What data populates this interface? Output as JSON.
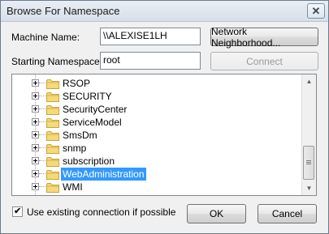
{
  "window": {
    "title": "Browse For Namespace",
    "close_glyph": "✕"
  },
  "machine": {
    "label": "Machine Name:",
    "value": "\\\\ALEXISE1LH"
  },
  "namespace": {
    "label": "Starting Namespace:",
    "value": "root"
  },
  "buttons": {
    "network": "Network Neighborhood...",
    "connect": "Connect",
    "ok": "OK",
    "cancel": "Cancel"
  },
  "tree": {
    "items": [
      {
        "label": "RSOP",
        "icon": "folder-icon",
        "selected": false
      },
      {
        "label": "SECURITY",
        "icon": "folder-icon",
        "selected": false
      },
      {
        "label": "SecurityCenter",
        "icon": "folder-icon",
        "selected": false
      },
      {
        "label": "ServiceModel",
        "icon": "folder-icon",
        "selected": false
      },
      {
        "label": "SmsDm",
        "icon": "folder-icon",
        "selected": false
      },
      {
        "label": "snmp",
        "icon": "folder-icon",
        "selected": false
      },
      {
        "label": "subscription",
        "icon": "folder-icon",
        "selected": false
      },
      {
        "label": "WebAdministration",
        "icon": "folder-icon",
        "selected": true
      },
      {
        "label": "WMI",
        "icon": "folder-icon",
        "selected": false
      }
    ],
    "selection_color": "#3399ff"
  },
  "options": {
    "use_existing_label": "Use existing connection if possible",
    "use_existing_checked": true
  },
  "colors": {
    "folder_fill": "#f5d97a",
    "folder_stroke": "#c9a53a"
  }
}
